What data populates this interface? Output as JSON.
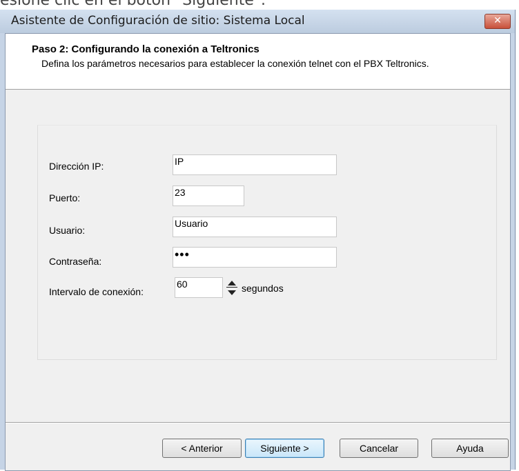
{
  "background_caption": "esione clic en el botón \"Siguiente\".",
  "window": {
    "title": "Asistente de Configuración de sitio: Sistema Local",
    "close_label": "✕"
  },
  "header": {
    "step": "Paso 2: Configurando la conexión a Teltronics",
    "description": "Defina los parámetros necesarios para establecer la conexión telnet con el PBX Teltronics."
  },
  "form": {
    "ip_label": "Dirección IP:",
    "ip_value": "IP",
    "port_label": "Puerto:",
    "port_value": "23",
    "user_label": "Usuario:",
    "user_value": "Usuario",
    "password_label": "Contraseña:",
    "password_value": "•••",
    "interval_label": "Intervalo de conexión:",
    "interval_value": "60",
    "interval_unit": "segundos"
  },
  "buttons": {
    "back": "< Anterior",
    "next": "Siguiente >",
    "cancel": "Cancelar",
    "help": "Ayuda"
  },
  "colors": {
    "title_bar": "#c6d4e6",
    "dialog_bg": "#f0f0f0",
    "close_button": "#c8503a",
    "default_button_border": "#3c7fb1"
  }
}
